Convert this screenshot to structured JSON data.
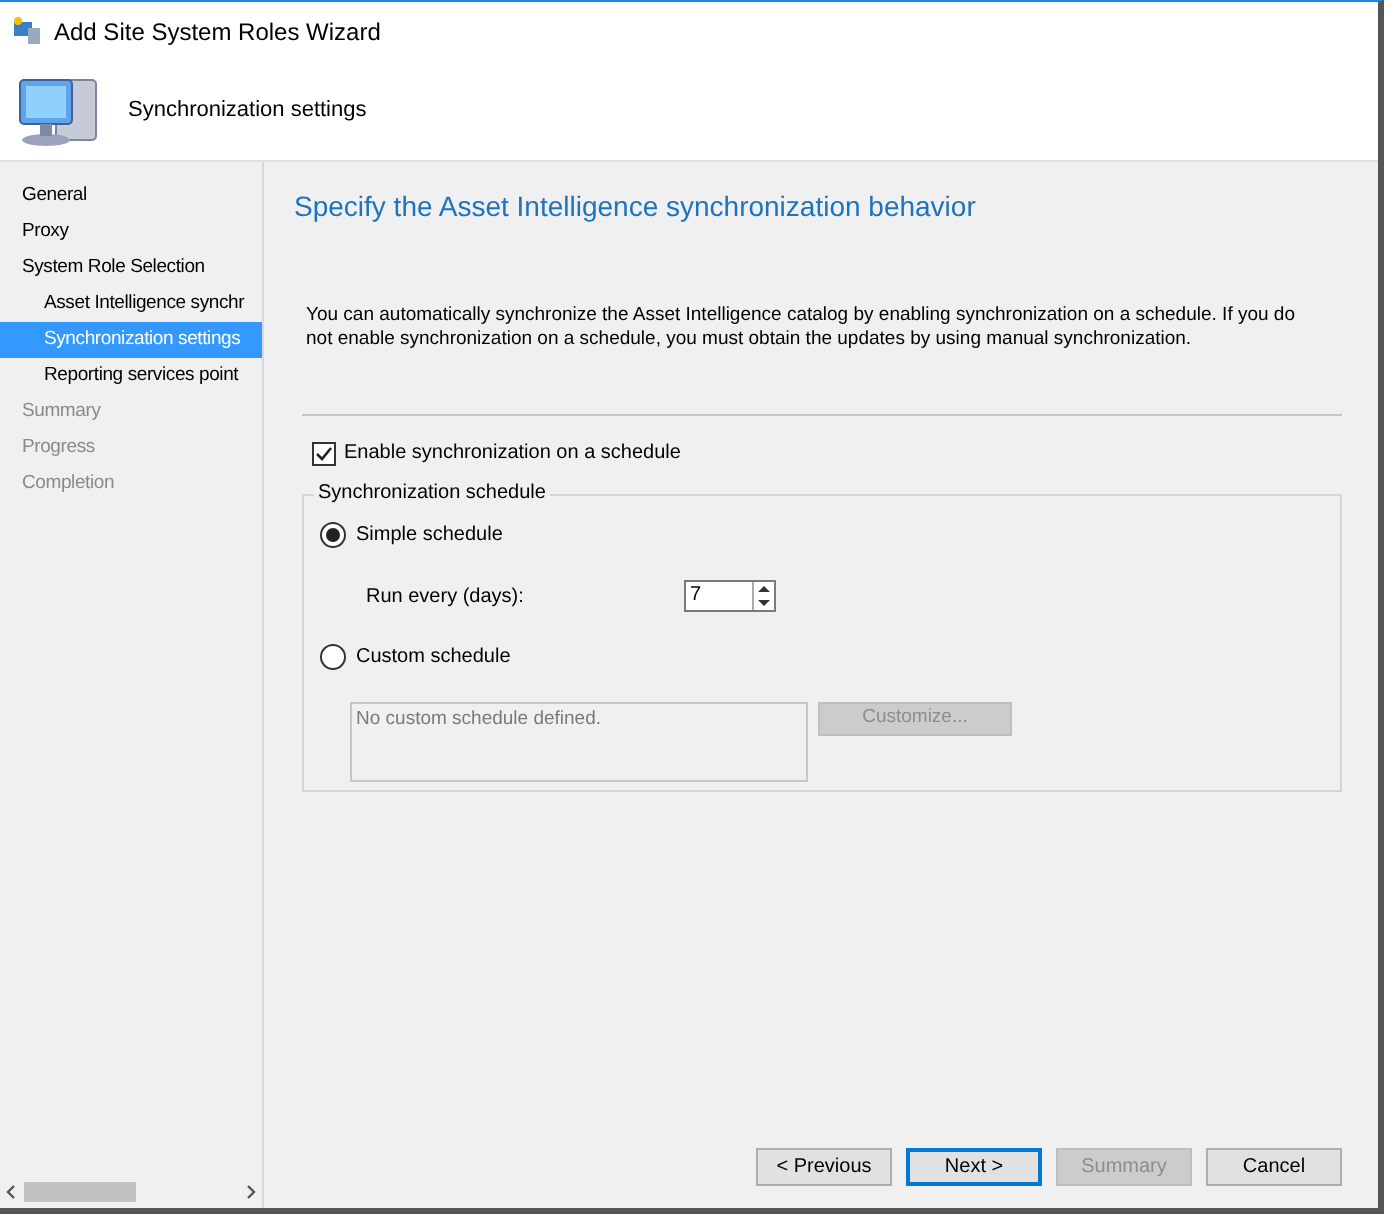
{
  "window": {
    "title": "Add Site System Roles Wizard"
  },
  "header": {
    "title": "Synchronization settings"
  },
  "sidebar": {
    "items": [
      {
        "label": "General",
        "selected": false,
        "disabled": false
      },
      {
        "label": "Proxy",
        "selected": false,
        "disabled": false
      },
      {
        "label": "System Role Selection",
        "selected": false,
        "disabled": false,
        "children": [
          {
            "label": "Asset Intelligence synchr",
            "selected": false,
            "disabled": false
          },
          {
            "label": "Synchronization settings",
            "selected": true,
            "disabled": false
          },
          {
            "label": "Reporting services point",
            "selected": false,
            "disabled": false
          }
        ]
      },
      {
        "label": "Summary",
        "selected": false,
        "disabled": true
      },
      {
        "label": "Progress",
        "selected": false,
        "disabled": true
      },
      {
        "label": "Completion",
        "selected": false,
        "disabled": true
      }
    ]
  },
  "page": {
    "heading": "Specify the Asset Intelligence synchronization behavior",
    "description": "You can automatically synchronize the Asset Intelligence catalog by enabling synchronization on a schedule. If you do not enable synchronization on a schedule, you must obtain the updates by using manual synchronization.",
    "enable_checkbox": {
      "label": "Enable synchronization on a schedule",
      "checked": true
    },
    "group": {
      "title": "Synchronization schedule",
      "options": [
        {
          "label": "Simple schedule",
          "selected": true
        },
        {
          "label": "Custom schedule",
          "selected": false
        }
      ],
      "run_every": {
        "label": "Run every (days):",
        "value": "7"
      },
      "custom_box": {
        "text": "No custom schedule defined."
      },
      "customize_button": {
        "label": "Customize...",
        "disabled": true
      }
    }
  },
  "buttons": [
    {
      "label": "< Previous",
      "disabled": false,
      "default": false
    },
    {
      "label": "Next >",
      "disabled": false,
      "default": true
    },
    {
      "label": "Summary",
      "disabled": true,
      "default": false
    },
    {
      "label": "Cancel",
      "disabled": false,
      "default": false
    }
  ]
}
